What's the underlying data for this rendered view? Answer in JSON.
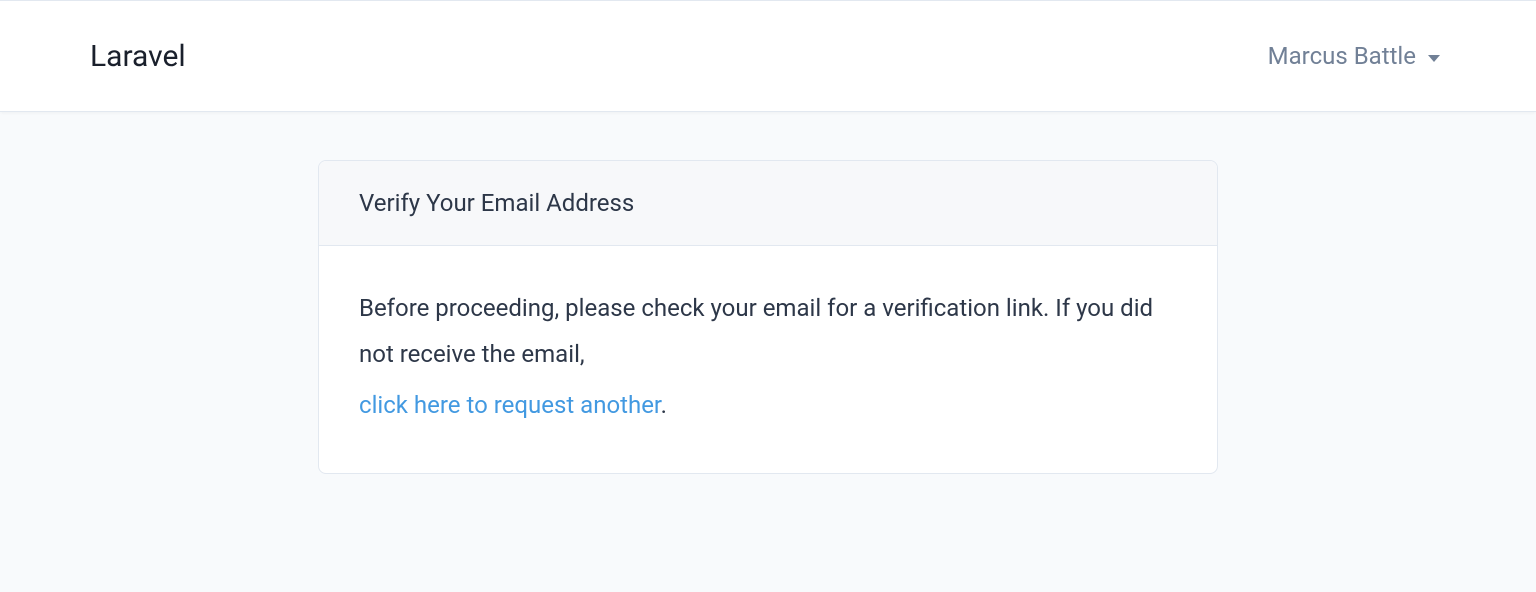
{
  "navbar": {
    "brand": "Laravel",
    "user_name": "Marcus Battle"
  },
  "card": {
    "header": "Verify Your Email Address",
    "body_text": "Before proceeding, please check your email for a verification link. If you did not receive the email,",
    "link_text": "click here to request another",
    "link_suffix": "."
  }
}
